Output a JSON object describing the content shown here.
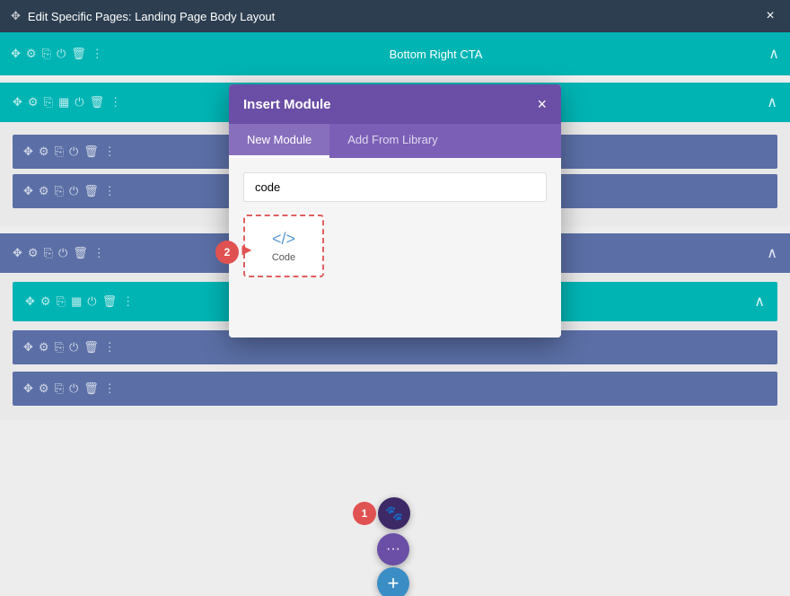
{
  "titleBar": {
    "title": "Edit Specific Pages: Landing Page Body Layout",
    "closeLabel": "×"
  },
  "topBar": {
    "label": "Bottom Right CTA",
    "chevron": "^"
  },
  "modal": {
    "title": "Insert Module",
    "closeLabel": "×",
    "tabs": [
      {
        "id": "new",
        "label": "New Module",
        "active": true
      },
      {
        "id": "library",
        "label": "Add From Library",
        "active": false
      }
    ],
    "searchPlaceholder": "code",
    "modules": [
      {
        "icon": "</>",
        "label": "Code"
      }
    ]
  },
  "floatButtons": {
    "step1Label": "1",
    "step2Label": "2",
    "dotsLabel": "···",
    "plusLabel": "+"
  },
  "toolbar": {
    "icons": [
      "✥",
      "⚙",
      "⎘",
      "▦",
      "⏻",
      "🗑",
      "⋮"
    ]
  }
}
